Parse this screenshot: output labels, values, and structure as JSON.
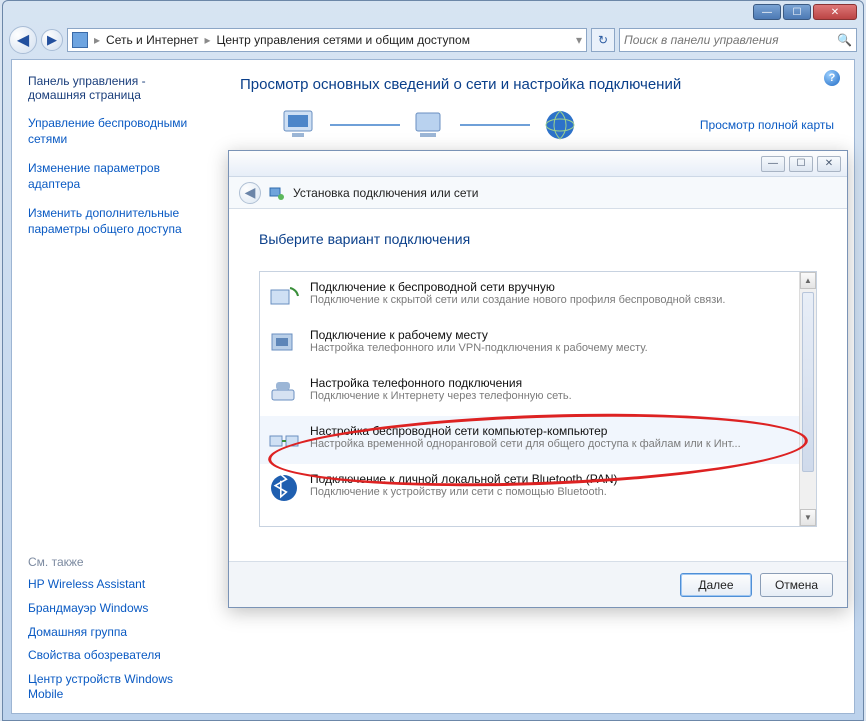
{
  "window": {
    "min": "—",
    "max": "☐",
    "close": "✕"
  },
  "toolbar": {
    "back_glyph": "◀",
    "fwd_glyph": "▶",
    "refresh_glyph": "↻",
    "search_glyph": "🔍"
  },
  "address": {
    "seg1": "Сеть и Интернет",
    "seg2": "Центр управления сетями и общим доступом",
    "dropdown_glyph": "▾",
    "sep": "▸"
  },
  "search": {
    "placeholder": "Поиск в панели управления"
  },
  "sidebar": {
    "home_line1": "Панель управления -",
    "home_line2": "домашняя страница",
    "links": [
      "Управление беспроводными сетями",
      "Изменение параметров адаптера",
      "Изменить дополнительные параметры общего доступа"
    ],
    "seealso_label": "См. также",
    "seealso": [
      "HP Wireless Assistant",
      "Брандмауэр Windows",
      "Домашняя группа",
      "Свойства обозревателя",
      "Центр устройств Windows Mobile"
    ]
  },
  "main": {
    "heading": "Просмотр основных сведений о сети и настройка подключений",
    "map_link": "Просмотр полной карты",
    "help_glyph": "?"
  },
  "dialog": {
    "winbtns": {
      "min": "—",
      "max": "☐",
      "close": "✕"
    },
    "back_glyph": "◀",
    "header_title": "Установка подключения или сети",
    "body_heading": "Выберите вариант подключения",
    "options": [
      {
        "title": "Подключение к беспроводной сети вручную",
        "desc": "Подключение к скрытой сети или создание нового профиля беспроводной связи."
      },
      {
        "title": "Подключение к рабочему месту",
        "desc": "Настройка телефонного или VPN-подключения к рабочему месту."
      },
      {
        "title": "Настройка телефонного подключения",
        "desc": "Подключение к Интернету через телефонную сеть."
      },
      {
        "title": "Настройка беспроводной сети компьютер-компьютер",
        "desc": "Настройка временной одноранговой сети для общего доступа к файлам или к Инт..."
      },
      {
        "title": "Подключение к личной локальной сети Bluetooth (PAN)",
        "desc": "Подключение к устройству или сети с помощью Bluetooth."
      }
    ],
    "next": "Далее",
    "cancel": "Отмена",
    "scroll_up": "▲",
    "scroll_down": "▼"
  }
}
